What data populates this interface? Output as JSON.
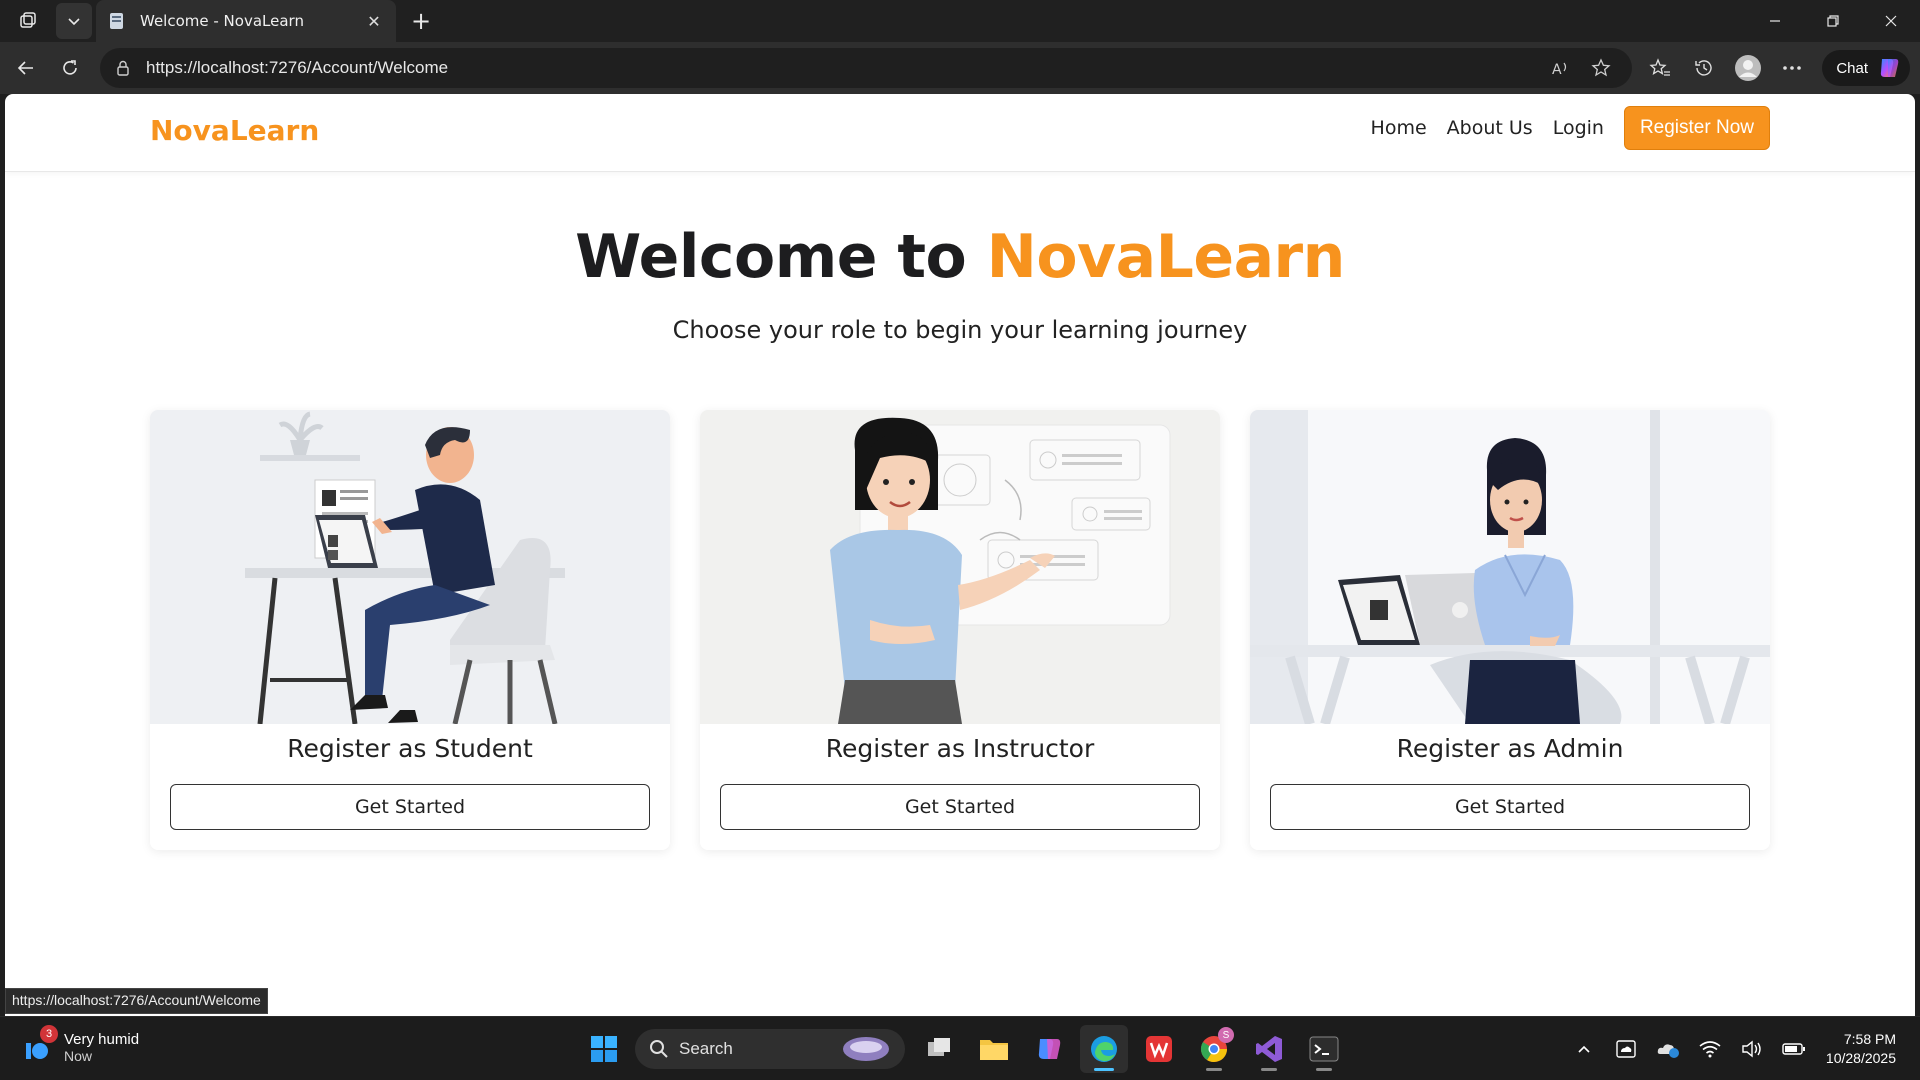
{
  "browser": {
    "tab_title": "Welcome - NovaLearn",
    "url": "https://localhost:7276/Account/Welcome",
    "chat_label": "Chat",
    "status_url": "https://localhost:7276/Account/Welcome"
  },
  "site": {
    "brand": "NovaLearn",
    "nav": {
      "home": "Home",
      "about": "About Us",
      "login": "Login",
      "register": "Register Now"
    },
    "hero": {
      "title_prefix": "Welcome to ",
      "title_accent": "NovaLearn",
      "subtitle": "Choose your role to begin your learning journey"
    },
    "cards": [
      {
        "title": "Register as Student",
        "button": "Get Started"
      },
      {
        "title": "Register as Instructor",
        "button": "Get Started"
      },
      {
        "title": "Register as Admin",
        "button": "Get Started"
      }
    ],
    "colors": {
      "accent": "#f7931e",
      "text": "#1d1d1f"
    }
  },
  "taskbar": {
    "weather_text": "Very humid",
    "weather_sub": "Now",
    "weather_badge": "3",
    "search_label": "Search",
    "chrome_badge": "S",
    "time": "7:58 PM",
    "date": "10/28/2025"
  }
}
